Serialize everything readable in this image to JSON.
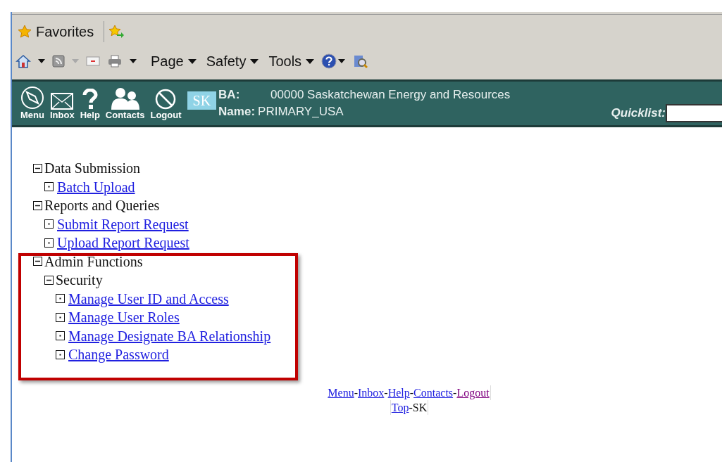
{
  "toolbar": {
    "favorites": "Favorites",
    "menus": [
      "Page",
      "Safety",
      "Tools"
    ]
  },
  "header": {
    "nav": [
      {
        "label": "Menu",
        "kind": "compass"
      },
      {
        "label": "Inbox",
        "kind": "envelope"
      },
      {
        "label": "Help",
        "kind": "question"
      },
      {
        "label": "Contacts",
        "kind": "people"
      },
      {
        "label": "Logout",
        "kind": "prohibit"
      }
    ],
    "region": "SK",
    "ba_label": "BA:",
    "ba_value": "00000 Saskatchewan Energy and Resources",
    "name_label": "Name:",
    "name_value": "PRIMARY_USA",
    "quicklist_label": "Quicklist:"
  },
  "tree": [
    {
      "label": "Data Submission",
      "kind": "folder",
      "expanded": true,
      "children": [
        {
          "label": "Batch Upload",
          "kind": "link"
        }
      ]
    },
    {
      "label": "Reports and Queries",
      "kind": "folder",
      "expanded": true,
      "children": [
        {
          "label": "Submit Report Request",
          "kind": "link"
        },
        {
          "label": "Upload Report Request",
          "kind": "link"
        }
      ]
    },
    {
      "label": "Admin Functions",
      "kind": "folder",
      "expanded": true,
      "children": [
        {
          "label": "Security",
          "kind": "folder",
          "expanded": true,
          "children": [
            {
              "label": "Manage User ID and Access",
              "kind": "link"
            },
            {
              "label": "Manage User Roles",
              "kind": "link"
            },
            {
              "label": "Manage Designate BA Relationship",
              "kind": "link"
            },
            {
              "label": "Change Password",
              "kind": "link"
            }
          ]
        }
      ]
    }
  ],
  "footer": {
    "links": [
      {
        "label": "Menu",
        "visited": false
      },
      {
        "label": "Inbox",
        "visited": false
      },
      {
        "label": "Help",
        "visited": false
      },
      {
        "label": "Contacts",
        "visited": false
      },
      {
        "label": "Logout",
        "visited": true
      }
    ],
    "separator": "-",
    "top_link": "Top",
    "region": "SK"
  }
}
